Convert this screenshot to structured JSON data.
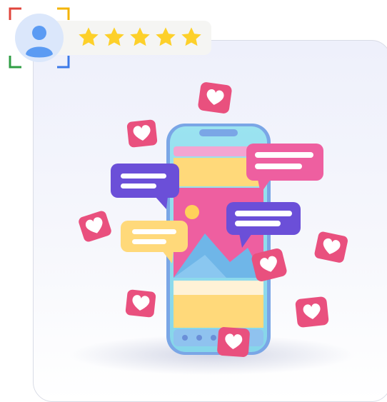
{
  "rating": {
    "stars_filled": 5,
    "stars_total": 5
  },
  "colors": {
    "star": "#fdd02a",
    "avatar": "#5b9bf3",
    "bubble_pink": "#ee5fa0",
    "bubble_purple": "#6b4fd8",
    "bubble_yellow": "#ffd97a",
    "heart_card": "#e9507e",
    "phone_frame": "#8fb6ea"
  },
  "icons": {
    "avatar": "user-avatar-icon",
    "star": "star-icon",
    "heart": "heart-icon",
    "chat": "chat-bubble-icon"
  }
}
